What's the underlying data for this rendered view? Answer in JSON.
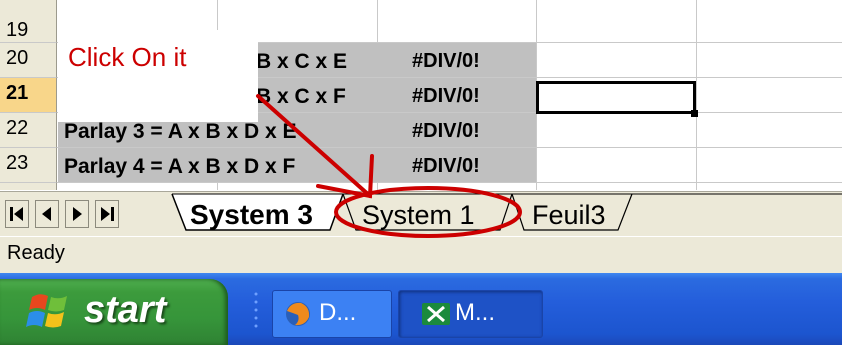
{
  "rows": [
    {
      "num": "19",
      "formula": "",
      "result": ""
    },
    {
      "num": "20",
      "formula": "B x C x E",
      "result": "#DIV/0!"
    },
    {
      "num": "21",
      "formula": "B x C x F",
      "result": "#DIV/0!"
    },
    {
      "num": "22",
      "formula": "Parlay 3 = A x B x D x E",
      "result": "#DIV/0!"
    },
    {
      "num": "23",
      "formula": "Parlay 4 = A x B x D x F",
      "result": "#DIV/0!"
    }
  ],
  "annotation": {
    "text": "Click On it",
    "color": "#cc0000"
  },
  "sheet_tabs": {
    "active": "System 3",
    "others": [
      "System 1",
      "Feuil3"
    ]
  },
  "status": {
    "text": "Ready"
  },
  "taskbar": {
    "start_label": "start",
    "tasks": [
      {
        "label": "D...",
        "icon": "firefox-icon"
      },
      {
        "label": "M...",
        "icon": "excel-icon"
      }
    ]
  },
  "colors": {
    "selection_shade": "#c0c0c0",
    "annotation_red": "#cc0000",
    "taskbar_blue": "#245edb",
    "start_green": "#3c9b3c"
  }
}
